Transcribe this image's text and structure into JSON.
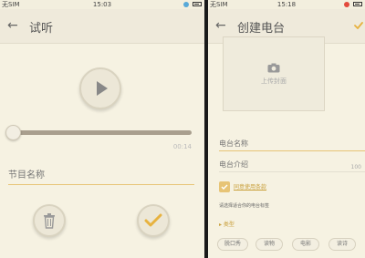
{
  "left": {
    "status": {
      "carrier": "无SIM",
      "time": "15:03"
    },
    "appbar": {
      "back": "←",
      "title": "试听"
    },
    "player": {
      "duration": "00:14",
      "progress": 0.0
    },
    "title_input": {
      "placeholder": "节目名称"
    }
  },
  "right": {
    "status": {
      "carrier": "无SIM",
      "time": "15:18"
    },
    "appbar": {
      "back": "←",
      "title": "创建电台"
    },
    "cover": {
      "label": "上传封面"
    },
    "form": {
      "name_placeholder": "电台名称",
      "intro_placeholder": "电台介绍",
      "intro_count": "100",
      "agree_label": "同意使用条款",
      "category_hint": "请选择适合你的电台标签",
      "category_toggle": "▸ 类型"
    },
    "tags": [
      "脱口秀",
      "读物",
      "电影",
      "读诗"
    ]
  },
  "colors": {
    "accent": "#e7c476",
    "background": "#f6f2e2"
  }
}
